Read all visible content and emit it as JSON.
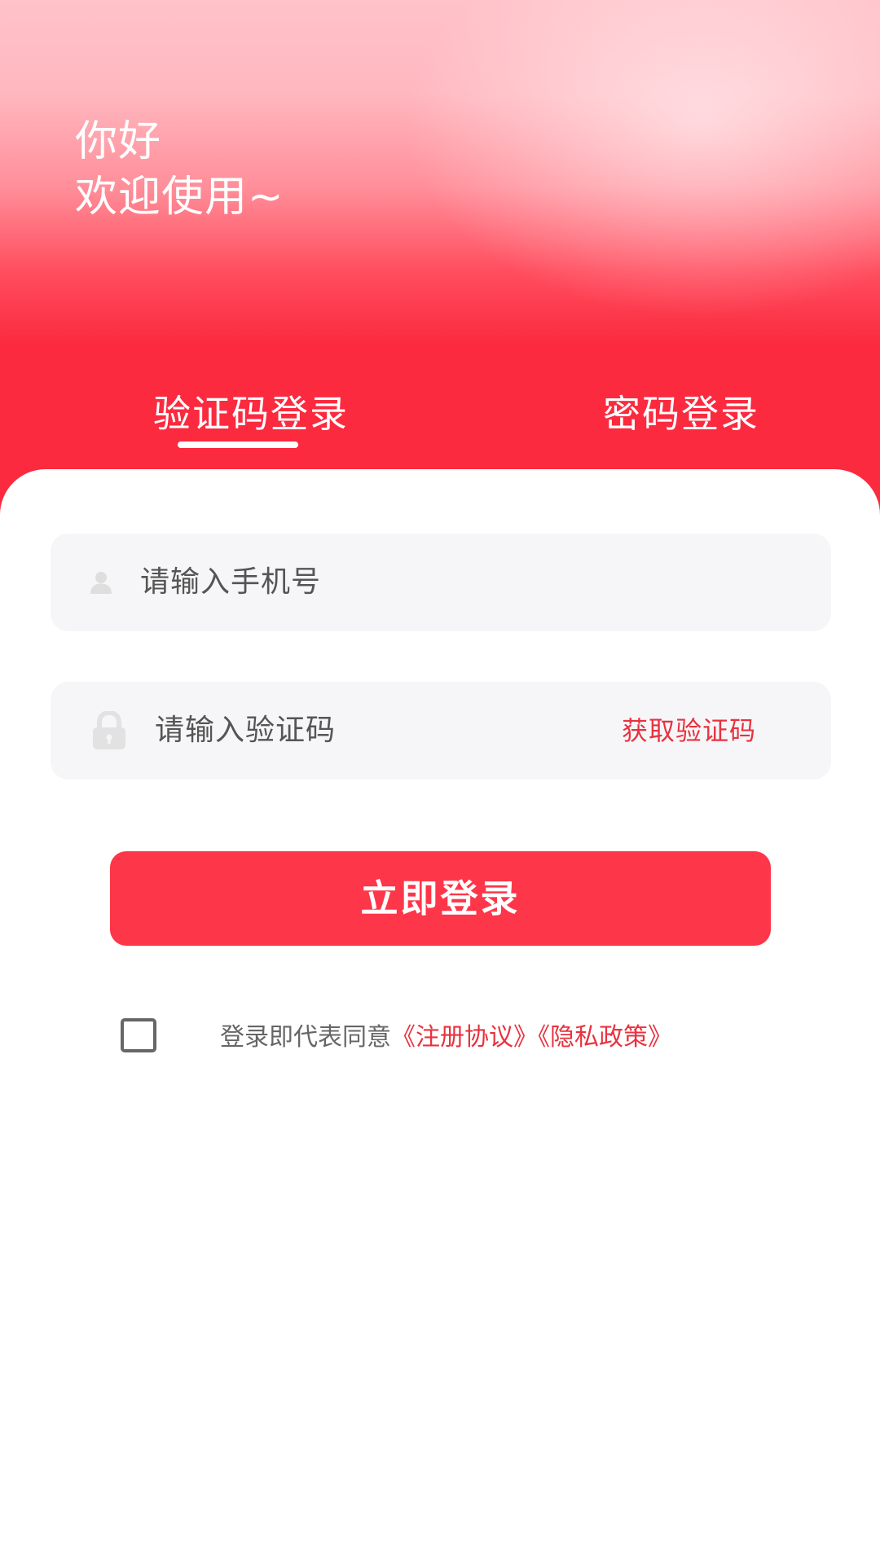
{
  "header": {
    "greeting_line1": "你好",
    "greeting_line2": "欢迎使用~"
  },
  "tabs": {
    "code_login": "验证码登录",
    "password_login": "密码登录",
    "active": "code_login"
  },
  "form": {
    "phone_placeholder": "请输入手机号",
    "code_placeholder": "请输入验证码",
    "get_code_label": "获取验证码",
    "phone_icon": "user-icon",
    "code_icon": "lock-icon"
  },
  "login_button": {
    "label": "立即登录"
  },
  "agreement": {
    "checked": false,
    "prefix": "登录即代表同意",
    "register_agreement": "《注册协议》",
    "privacy_policy": "《隐私政策》"
  },
  "colors": {
    "brand_red": "#fe3649",
    "link_red": "#e8323f",
    "header_top": "#ffc2c9",
    "header_bottom": "#fb2a3f",
    "field_bg": "#f6f6f8"
  }
}
